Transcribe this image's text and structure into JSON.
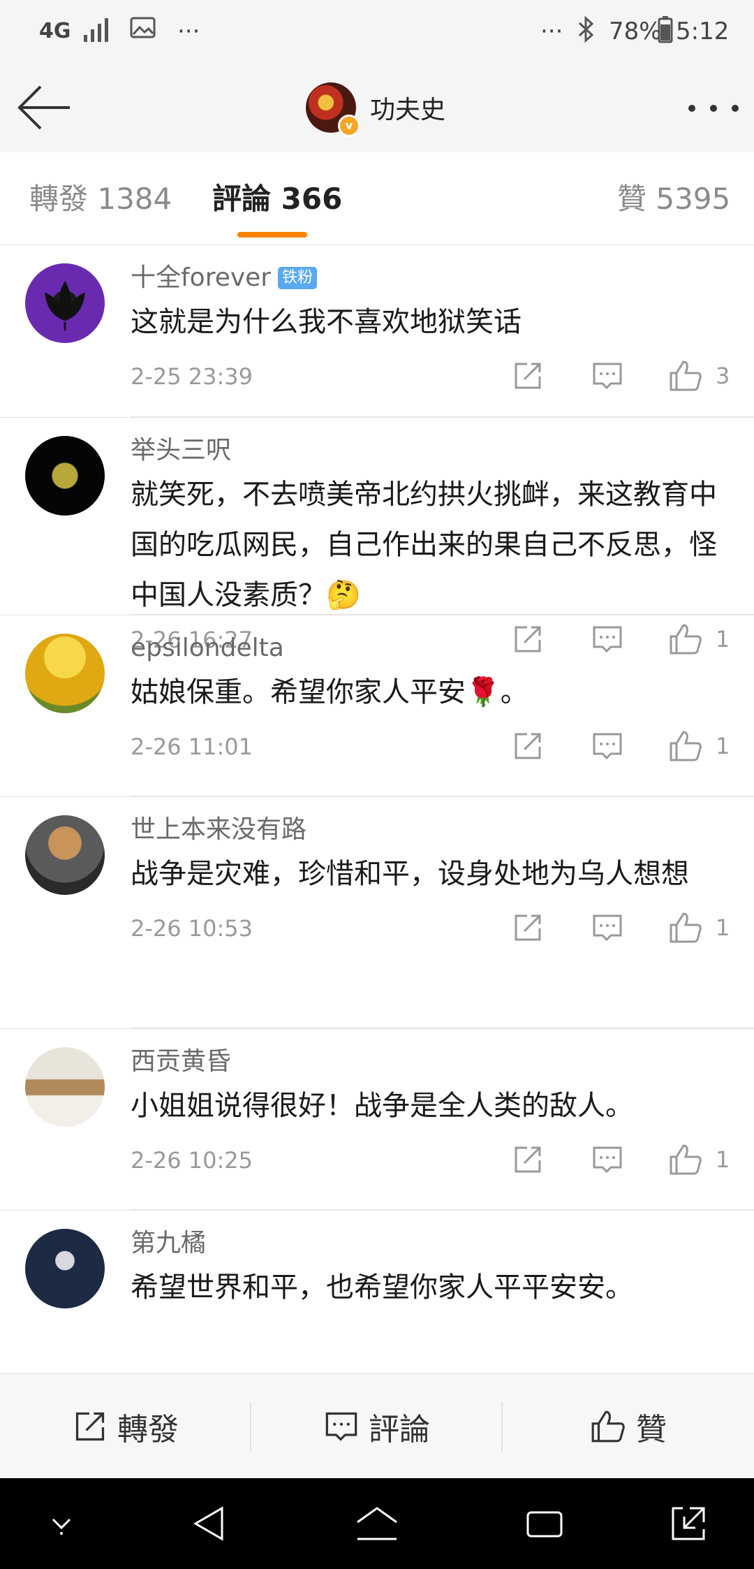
{
  "status_bar": {
    "network": "4G",
    "more_left": "···",
    "more_right": "···",
    "battery": "78%",
    "time": "5:12"
  },
  "header": {
    "title": "功夫史"
  },
  "tabs": [
    {
      "label": "轉發 1384"
    },
    {
      "label": "評論 366"
    },
    {
      "label": "贊 5395"
    }
  ],
  "comments": [
    {
      "user": "十全forever",
      "badge": "铁粉",
      "text": "这就是为什么我不喜欢地狱笑话",
      "time": "2-25 23:39",
      "likes": "3"
    },
    {
      "user": "举头三呎",
      "badge": "",
      "text": "就笑死，不去喷美帝北约拱火挑衅，来这教育中国的吃瓜网民，自己作出来的果自己不反思，怪中国人没素质？🤔",
      "time": "2-26 16:27",
      "likes": "1"
    },
    {
      "user": "epsilondelta",
      "badge": "",
      "text": "姑娘保重。希望你家人平安🌹。",
      "time": "2-26 11:01",
      "likes": "1"
    },
    {
      "user": "世上本来没有路",
      "badge": "",
      "text": "战争是灾难，珍惜和平，设身处地为乌人想想",
      "time": "2-26 10:53",
      "likes": "1"
    },
    {
      "user": "西贡黄昏",
      "badge": "",
      "text": "小姐姐说得很好！战争是全人类的敌人。",
      "time": "2-26 10:25",
      "likes": "1"
    },
    {
      "user": "第九橘",
      "badge": "",
      "text": "希望世界和平，也希望你家人平平安安。",
      "time": "",
      "likes": ""
    }
  ],
  "bottom_bar": {
    "repost": "轉發",
    "comment": "評論",
    "like": "贊"
  },
  "colors": {
    "accent": "#ff8200",
    "fan_badge": "#5aa9ee"
  }
}
